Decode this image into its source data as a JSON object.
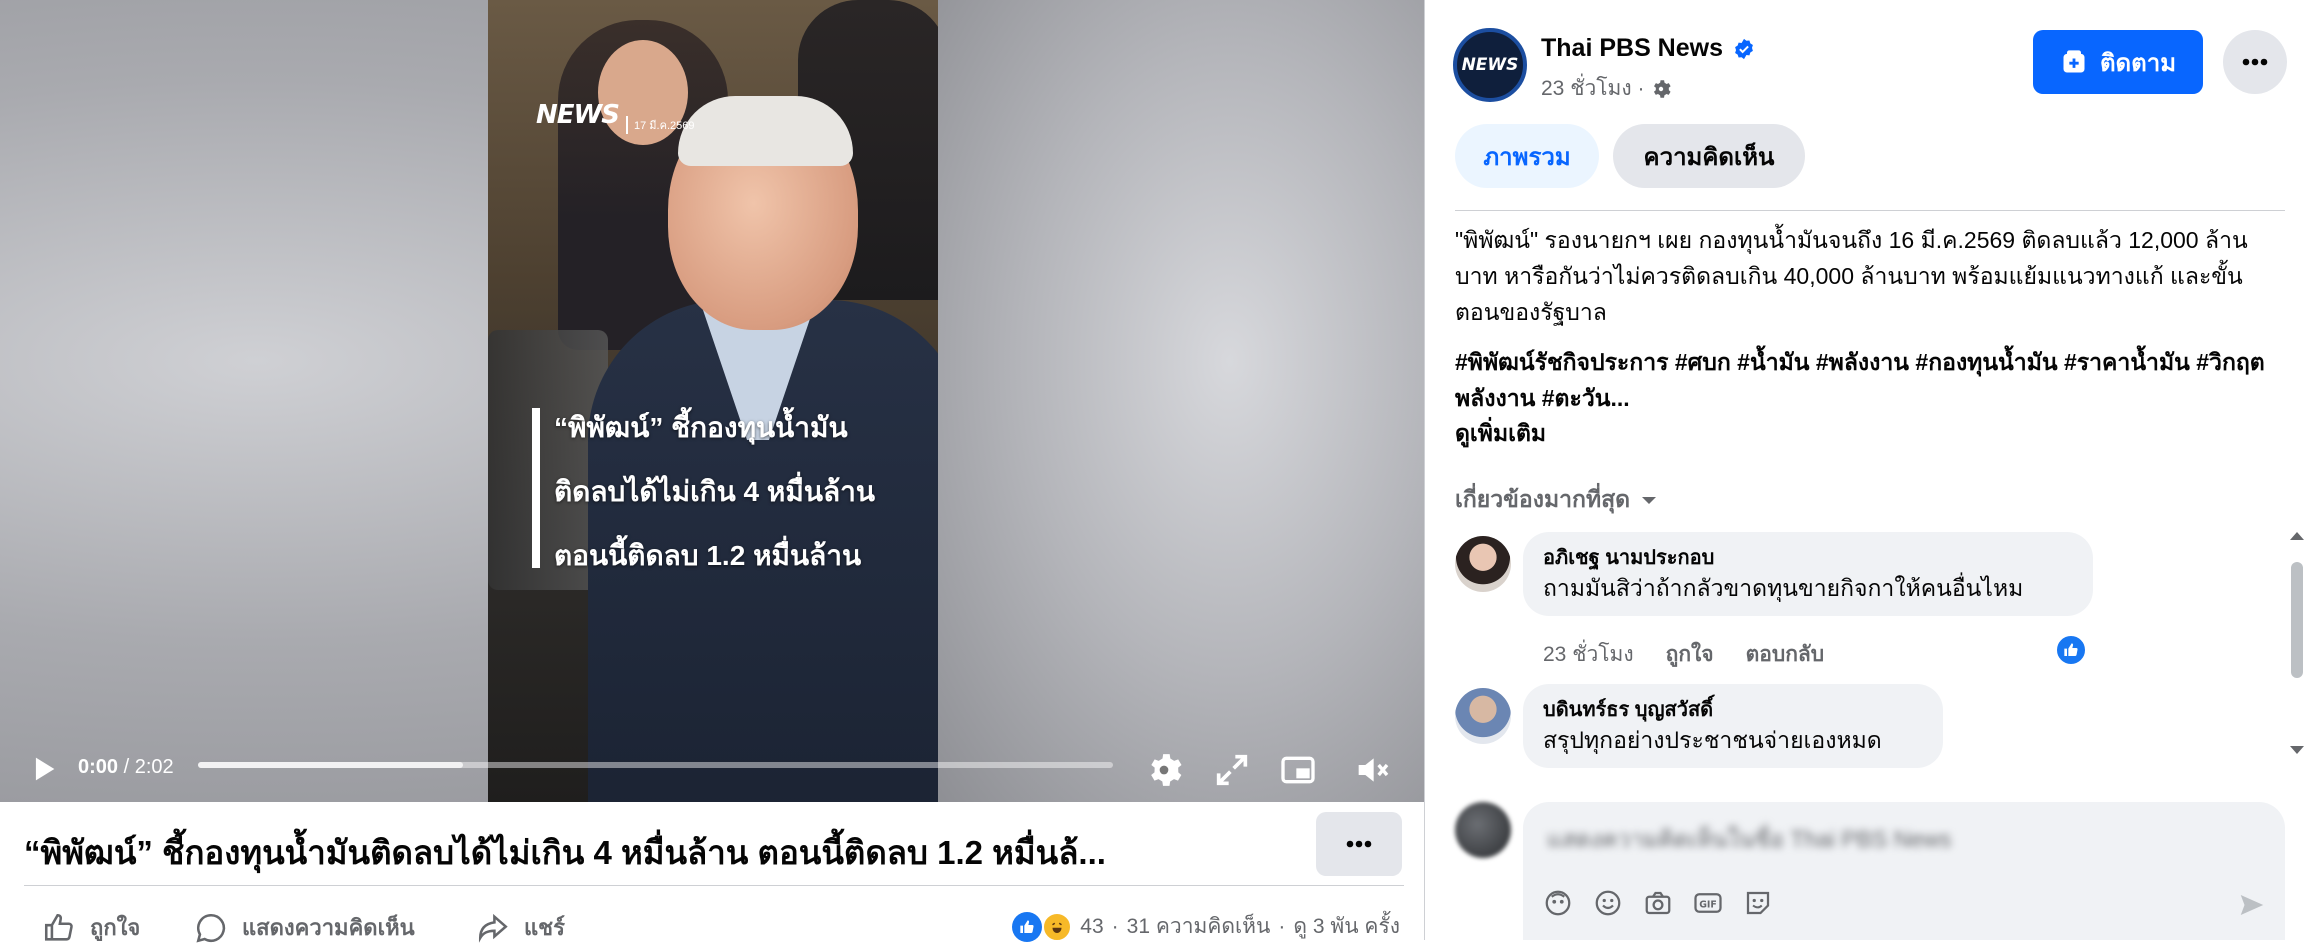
{
  "video": {
    "overlay_logo": "NEWS",
    "overlay_date": "17 มี.ค.2569",
    "caption_lines": [
      "“พิพัฒน์” ชี้กองทุนน้ำมัน",
      "ติดลบได้ไม่เกิน 4 หมื่นล้าน",
      "ตอนนี้ติดลบ 1.2 หมื่นล้าน"
    ],
    "current_time": "0:00",
    "time_separator": "/ 2:02",
    "buffered_fraction": 0.29,
    "title": "“พิพัฒน์” ชี้กองทุนน้ำมันติดลบได้ไม่เกิน 4 หมื่นล้าน ตอนนี้ติดลบ 1.2 หมื่นล้..."
  },
  "actions": {
    "like": "ถูกใจ",
    "comment": "แสดงความคิดเห็น",
    "share": "แชร์"
  },
  "stats": {
    "reactions": "43",
    "comments": "31 ความคิดเห็น",
    "views": "ดู 3 พัน ครั้ง",
    "sep": "·"
  },
  "page": {
    "avatar_text": "NEWS",
    "name": "Thai PBS News",
    "time": "23 ชั่วโมง ·",
    "follow_label": "ติดตาม"
  },
  "tabs": {
    "overview": "ภาพรวม",
    "comments": "ความคิดเห็น"
  },
  "post": {
    "body": "\"พิพัฒน์\" รองนายกฯ เผย กองทุนน้ำมันจนถึง 16 มี.ค.2569 ติดลบแล้ว 12,000 ล้านบาท หารือกันว่าไม่ควรติดลบเกิน 40,000 ล้านบาท พร้อมแย้มแนวทางแก้ และขั้นตอนของรัฐบาล",
    "hashtags": "#พิพัฒน์รัชกิจประการ #ศบก #น้ำมัน #พลังงาน #กองทุนน้ำมัน #ราคาน้ำมัน #วิกฤตพลังงาน #ตะวัน...",
    "see_more": "ดูเพิ่มเติม"
  },
  "comments_section": {
    "sort_label": "เกี่ยวข้องมากที่สุด",
    "items": [
      {
        "author": "อภิเชฐ นามประกอบ",
        "text": "ถามมันสิว่าถ้ากลัวขาดทุนขายกิจกาให้คนอื่นไหม",
        "time": "23 ชั่วโมง",
        "like": "ถูกใจ",
        "reply": "ตอบกลับ"
      },
      {
        "author": "บดินทร์ธร บุญสวัสดิ์",
        "text": "สรุปทุกอย่างประชาชนจ่ายเองหมด"
      }
    ]
  },
  "composer": {
    "placeholder": "แสดงความคิดเห็นในชื่อ Thai PBS News"
  },
  "colors": {
    "accent": "#0866ff",
    "like_blue": "#1877f2",
    "muted_text": "#65676b",
    "bubble_bg": "#f0f2f5"
  },
  "icons": [
    "play-icon",
    "settings-icon",
    "fullscreen-icon",
    "pip-icon",
    "mute-icon",
    "more-icon",
    "like-icon",
    "comment-icon",
    "share-icon",
    "verified-icon",
    "gear-icon",
    "follow-icon",
    "chevron-down-icon",
    "avatar-sticker-icon",
    "emoji-icon",
    "camera-icon",
    "gif-icon",
    "sticker-icon",
    "send-icon"
  ]
}
